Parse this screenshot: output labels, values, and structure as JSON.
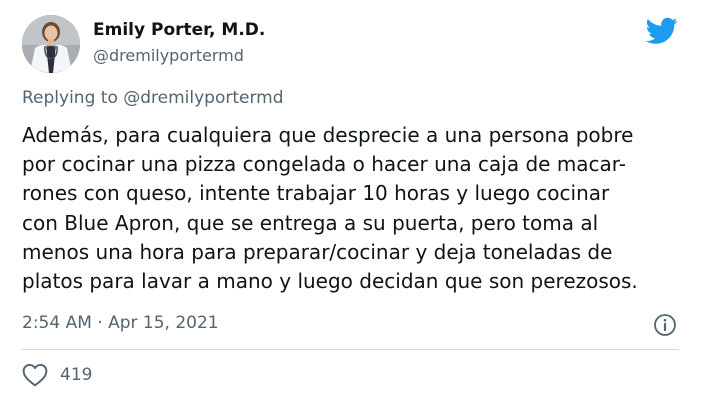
{
  "author": {
    "name": "Emily Porter, M.D.",
    "handle": "@dremilyportermd",
    "avatar_icon": "profile-photo"
  },
  "reply": {
    "prefix": "Replying to ",
    "mention": "@dremilyportermd"
  },
  "tweet": {
    "lines": [
      "Además, para cualquiera que desprecie a una persona pobre",
      "por cocinar una pizza congelada o hacer una caja de macar-",
      "rones con queso, intente trabajar 10 horas y luego cocinar",
      "con Blue Apron, que se entrega a su puerta, pero toma al",
      "menos una hora para preparar/cocinar y deja toneladas de",
      "platos para lavar a mano y luego decidan que son perezosos."
    ],
    "timestamp": "2:54 AM · Apr 15, 2021"
  },
  "actions": {
    "like_icon": "heart-icon",
    "like_count": "419",
    "info_icon": "info-icon"
  },
  "colors": {
    "brand": "#1d9bf0",
    "text": "#0f1419",
    "secondary": "#536471",
    "divider": "#cfd9de"
  }
}
